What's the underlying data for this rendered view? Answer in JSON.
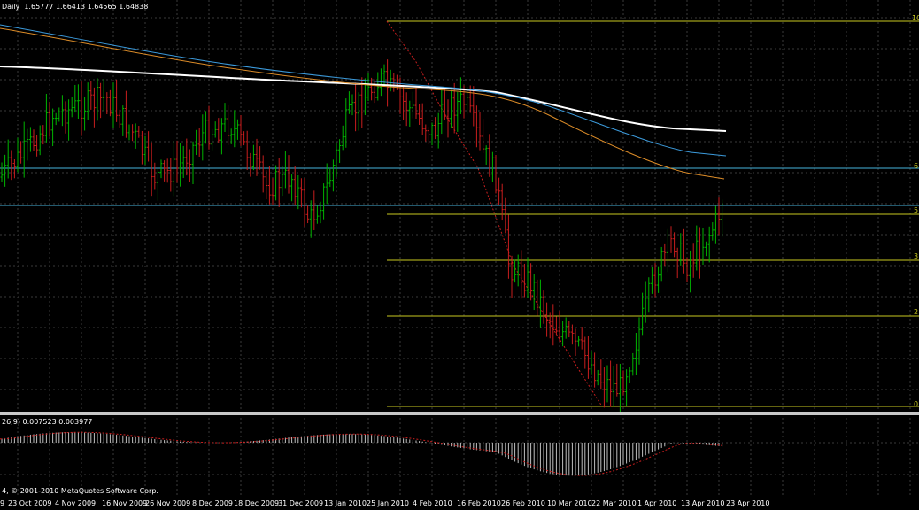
{
  "window": {
    "main_title_prefix": "Daily",
    "ohlc": "1.65777 1.66413 1.64565 1.64838"
  },
  "indicator_header": {
    "params_suffix": "26,9)",
    "values": "0.007523 0.003977"
  },
  "copyright": "4, © 2001-2010 MetaQuotes Software Corp.",
  "colors": {
    "background": "#000000",
    "grid": "#3a3a3a",
    "bull_candle": "#00b400",
    "bear_candle": "#c81e1e",
    "ma_white": "#ffffff",
    "ma_blue": "#3c9bdc",
    "ma_orange": "#dc8c28",
    "fibonacci": "#c8c820",
    "horizontal_line": "#46b4dc",
    "macd_histogram": "#c0c0c0",
    "signal_line": "#c81e1e"
  },
  "fib_labels": [
    "10",
    "6",
    "5",
    "3",
    "2",
    "0"
  ],
  "date_labels": [
    "9",
    "23 Oct 2009",
    "4 Nov 2009",
    "16 Nov 2009",
    "26 Nov 2009",
    "8 Dec 2009",
    "18 Dec 2009",
    "31 Dec 2009",
    "13 Jan 2010",
    "25 Jan 2010",
    "4 Feb 2010",
    "16 Feb 2010",
    "26 Feb 2010",
    "10 Mar 2010",
    "22 Mar 2010",
    "1 Apr 2010",
    "13 Apr 2010",
    "23 Apr 2010"
  ],
  "chart_data": {
    "type": "candlestick",
    "instrument_period": "Daily",
    "last_bar": {
      "open": 1.65777,
      "high": 1.66413,
      "low": 1.64565,
      "close": 1.64838
    },
    "macd": {
      "main": 0.007523,
      "signal": 0.003977
    },
    "fibonacci_levels": [
      "10",
      "6",
      "5",
      "3",
      "2",
      "0"
    ],
    "x_dates": [
      "23 Oct 2009",
      "4 Nov 2009",
      "16 Nov 2009",
      "26 Nov 2009",
      "8 Dec 2009",
      "18 Dec 2009",
      "31 Dec 2009",
      "13 Jan 2010",
      "25 Jan 2010",
      "4 Feb 2010",
      "16 Feb 2010",
      "26 Feb 2010",
      "10 Mar 2010",
      "22 Mar 2010",
      "1 Apr 2010",
      "13 Apr 2010",
      "23 Apr 2010"
    ]
  }
}
